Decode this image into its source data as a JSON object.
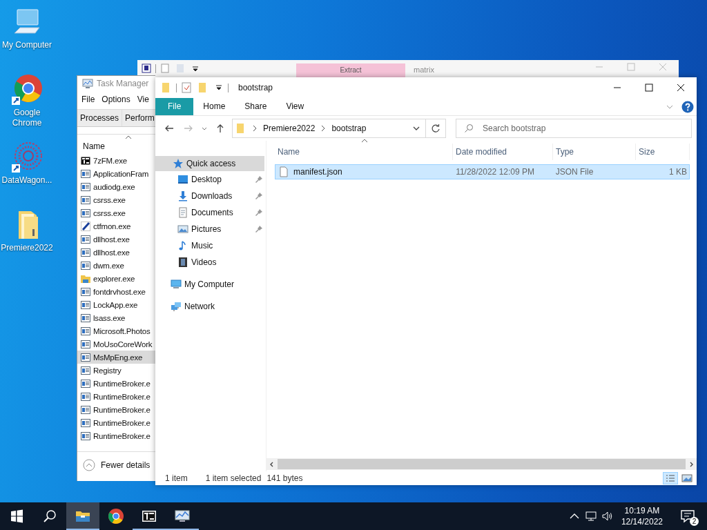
{
  "desktop_icons": [
    {
      "label": "My Computer",
      "kind": "computer",
      "shortcut": false
    },
    {
      "label": "Google Chrome",
      "kind": "chrome",
      "shortcut": true
    },
    {
      "label": "DataWagon...",
      "kind": "mandala",
      "shortcut": true
    },
    {
      "label": "Premiere2022",
      "kind": "folder",
      "shortcut": false
    }
  ],
  "back_window": {
    "tab": "Extract",
    "title": "matrix"
  },
  "task_manager": {
    "title": "Task Manager",
    "menu": [
      "File",
      "Options",
      "Vie"
    ],
    "tabs": [
      "Processes",
      "Perform"
    ],
    "column": "Name",
    "processes": [
      {
        "name": "7zFM.exe",
        "kind": "archive",
        "selected": false
      },
      {
        "name": "ApplicationFram",
        "kind": "app",
        "selected": false
      },
      {
        "name": "audiodg.exe",
        "kind": "app",
        "selected": false
      },
      {
        "name": "csrss.exe",
        "kind": "app",
        "selected": false
      },
      {
        "name": "csrss.exe",
        "kind": "app",
        "selected": false
      },
      {
        "name": "ctfmon.exe",
        "kind": "pen",
        "selected": false
      },
      {
        "name": "dllhost.exe",
        "kind": "app",
        "selected": false
      },
      {
        "name": "dllhost.exe",
        "kind": "app",
        "selected": false
      },
      {
        "name": "dwm.exe",
        "kind": "app",
        "selected": false
      },
      {
        "name": "explorer.exe",
        "kind": "folder",
        "selected": false
      },
      {
        "name": "fontdrvhost.exe",
        "kind": "app",
        "selected": false
      },
      {
        "name": "LockApp.exe",
        "kind": "app",
        "selected": false
      },
      {
        "name": "lsass.exe",
        "kind": "app",
        "selected": false
      },
      {
        "name": "Microsoft.Photos",
        "kind": "app",
        "selected": false
      },
      {
        "name": "MoUsoCoreWork",
        "kind": "app",
        "selected": false
      },
      {
        "name": "MsMpEng.exe",
        "kind": "app",
        "selected": true
      },
      {
        "name": "Registry",
        "kind": "app",
        "selected": false
      },
      {
        "name": "RuntimeBroker.e",
        "kind": "app",
        "selected": false
      },
      {
        "name": "RuntimeBroker.e",
        "kind": "app",
        "selected": false
      },
      {
        "name": "RuntimeBroker.e",
        "kind": "app",
        "selected": false
      },
      {
        "name": "RuntimeBroker.e",
        "kind": "app",
        "selected": false
      },
      {
        "name": "RuntimeBroker.e",
        "kind": "app",
        "selected": false
      }
    ],
    "footer": "Fewer details"
  },
  "explorer": {
    "title": "bootstrap",
    "ribbon_tabs": [
      {
        "label": "File",
        "selected": true
      },
      {
        "label": "Home",
        "selected": false
      },
      {
        "label": "Share",
        "selected": false
      },
      {
        "label": "View",
        "selected": false
      }
    ],
    "path": [
      "Premiere2022",
      "bootstrap"
    ],
    "search": {
      "placeholder": "Search bootstrap"
    },
    "nav": [
      {
        "label": "Quick access",
        "kind": "star",
        "selected": true,
        "children": [
          {
            "label": "Desktop",
            "kind": "desktop",
            "selected": false,
            "pinned": true
          },
          {
            "label": "Downloads",
            "kind": "download",
            "selected": false,
            "pinned": true
          },
          {
            "label": "Documents",
            "kind": "documents",
            "selected": false,
            "pinned": true
          },
          {
            "label": "Pictures",
            "kind": "pictures",
            "selected": false,
            "pinned": true
          },
          {
            "label": "Music",
            "kind": "music",
            "selected": false,
            "pinned": false
          },
          {
            "label": "Videos",
            "kind": "videos",
            "selected": false,
            "pinned": false
          }
        ]
      },
      {
        "label": "My Computer",
        "kind": "computer",
        "selected": false
      },
      {
        "label": "Network",
        "kind": "network",
        "selected": false
      }
    ],
    "columns": [
      "Name",
      "Date modified",
      "Type",
      "Size"
    ],
    "files": [
      {
        "name": "manifest.json",
        "date": "11/28/2022 12:09 PM",
        "type": "JSON File",
        "size": "1 KB",
        "selected": true
      }
    ],
    "status": [
      "1 item",
      "1 item selected",
      "141 bytes"
    ]
  },
  "taskbar": {
    "apps": [
      {
        "kind": "explorer",
        "selected": true,
        "running": true
      },
      {
        "kind": "chrome",
        "selected": false,
        "running": false
      },
      {
        "kind": "archive",
        "selected": false,
        "running": true
      },
      {
        "kind": "taskmgr",
        "selected": false,
        "running": true
      }
    ],
    "time": "10:19 AM",
    "date": "12/14/2022",
    "notifications": "2"
  }
}
